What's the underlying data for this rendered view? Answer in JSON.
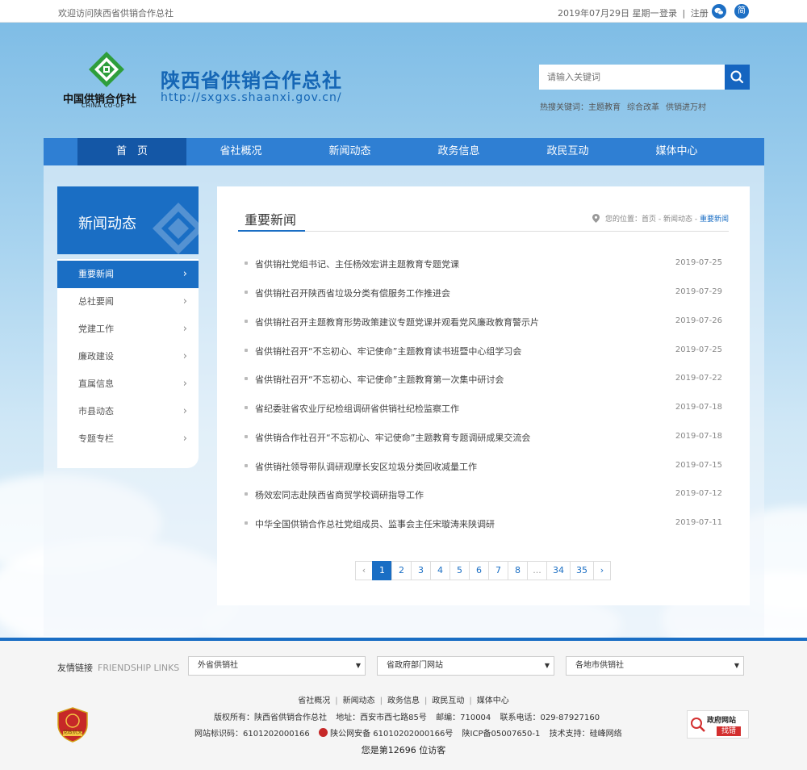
{
  "topbar": {
    "welcome": "欢迎访问陕西省供销合作总社",
    "date": "2019年07月29日 星期一",
    "login": "登录",
    "sep": "|",
    "register": "注册",
    "simplified": "简"
  },
  "header": {
    "logo_cn": "中国供销合作社",
    "logo_en": "CHINA CO-OP",
    "title": "陕西省供销合作总社",
    "url": "http://sxgxs.shaanxi.gov.cn/",
    "search_placeholder": "请输入关键词",
    "hot_label": "热搜关键词：",
    "hot_keywords": [
      "主题教育",
      "综合改革",
      "供销进万村"
    ]
  },
  "nav": [
    "首　页",
    "省社概况",
    "新闻动态",
    "政务信息",
    "政民互动",
    "媒体中心"
  ],
  "sidebar": {
    "title": "新闻动态",
    "items": [
      "重要新闻",
      "总社要闻",
      "党建工作",
      "廉政建设",
      "直属信息",
      "市县动态",
      "专题专栏"
    ]
  },
  "content": {
    "heading": "重要新闻",
    "breadcrumb_prefix": "您的位置：",
    "breadcrumb_home": "首页",
    "breadcrumb_sep": " - ",
    "breadcrumb_parent": "新闻动态",
    "breadcrumb_current": "重要新闻",
    "news": [
      {
        "title": "省供销社党组书记、主任杨效宏讲主题教育专题党课",
        "date": "2019-07-25"
      },
      {
        "title": "省供销社召开陕西省垃圾分类有偿服务工作推进会",
        "date": "2019-07-29"
      },
      {
        "title": "省供销社召开主题教育形势政策建议专题党课并观看党风廉政教育警示片",
        "date": "2019-07-26"
      },
      {
        "title": "省供销社召开“不忘初心、牢记使命”主题教育读书班暨中心组学习会",
        "date": "2019-07-25"
      },
      {
        "title": "省供销社召开“不忘初心、牢记使命”主题教育第一次集中研讨会",
        "date": "2019-07-22"
      },
      {
        "title": "省纪委驻省农业厅纪检组调研省供销社纪检监察工作",
        "date": "2019-07-18"
      },
      {
        "title": "省供销合作社召开“不忘初心、牢记使命”主题教育专题调研成果交流会",
        "date": "2019-07-18"
      },
      {
        "title": "省供销社领导带队调研观摩长安区垃圾分类回收减量工作",
        "date": "2019-07-15"
      },
      {
        "title": "杨效宏同志赴陕西省商贸学校调研指导工作",
        "date": "2019-07-12"
      },
      {
        "title": "中华全国供销合作总社党组成员、监事会主任宋璇涛来陕调研",
        "date": "2019-07-11"
      }
    ],
    "pager": [
      "‹",
      "1",
      "2",
      "3",
      "4",
      "5",
      "6",
      "7",
      "8",
      "...",
      "34",
      "35",
      "›"
    ]
  },
  "footer": {
    "links_label": "友情链接",
    "links_label_en": "FRIENDSHIP LINKS",
    "selects": [
      "外省供销社",
      "省政府部门网站",
      "各地市供销社"
    ],
    "bottom_links": [
      "省社概况",
      "新闻动态",
      "政务信息",
      "政民互动",
      "媒体中心"
    ],
    "copyright": "版权所有：陕西省供销合作总社",
    "address": "地址：西安市西七路85号",
    "postcode": "邮编：710004",
    "phone": "联系电话：029-87927160",
    "site_code": "网站标识码：6101202000166",
    "police": "陕公网安备 61010202000166号",
    "icp": "陕ICP备05007650-1",
    "support": "技术支持：硅峰网络",
    "visits": "您是第12696 位访客",
    "badge_text": "党政机关",
    "gov_line1": "政府网站",
    "gov_line2": "找错"
  }
}
